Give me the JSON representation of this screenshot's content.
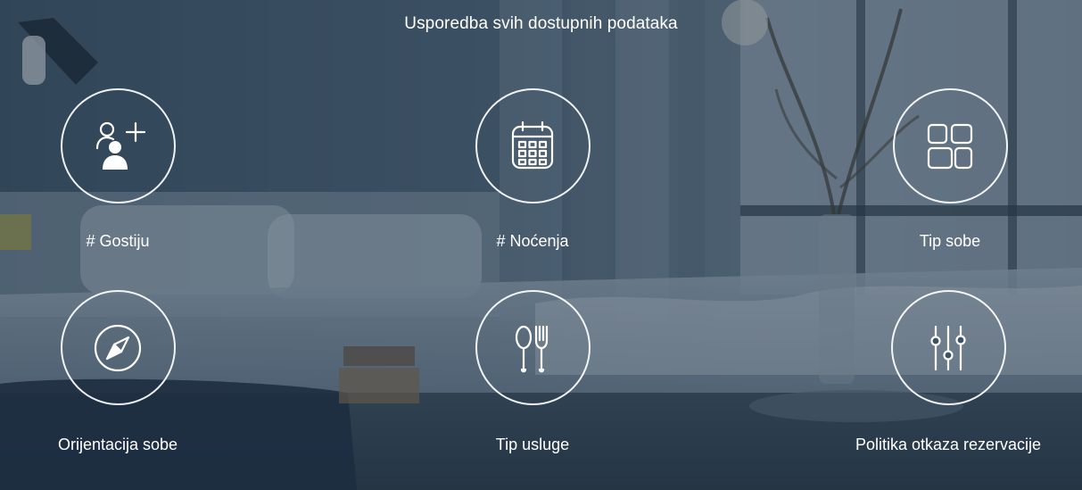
{
  "header": {
    "title": "Usporedba svih dostupnih podataka"
  },
  "features": [
    {
      "label": "# Gostiju",
      "icon": "add-user-icon"
    },
    {
      "label": "# Noćenja",
      "icon": "calendar-icon"
    },
    {
      "label": "Tip sobe",
      "icon": "room-layout-grid-icon"
    },
    {
      "label": "Orijentacija sobe",
      "icon": "compass-icon"
    },
    {
      "label": "Tip usluge",
      "icon": "spoon-fork-icon"
    },
    {
      "label": "Politika otkaza rezervacije",
      "icon": "sliders-icon"
    }
  ],
  "colors": {
    "text": "#ffffff",
    "icon_stroke": "#ffffff",
    "overlay": "#1c2e3e"
  }
}
